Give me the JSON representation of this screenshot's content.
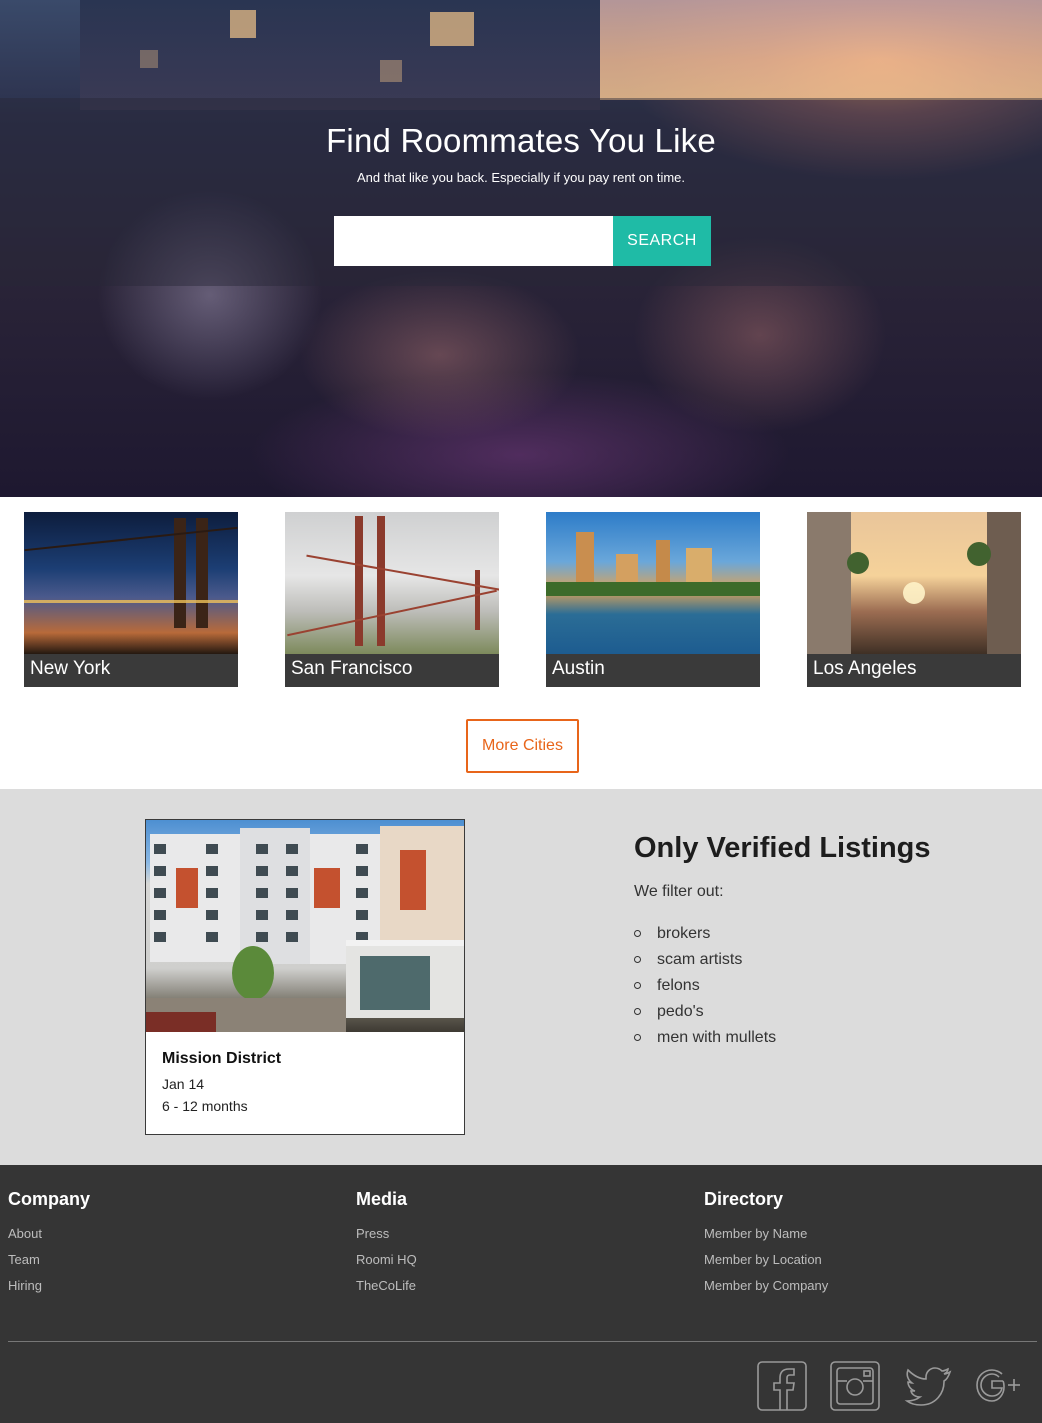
{
  "hero": {
    "title": "Find Roommates You Like",
    "subtitle": "And that like you back. Especially if you pay rent on time.",
    "search_placeholder": "",
    "search_button": "SEARCH"
  },
  "cities": [
    {
      "name": "New York"
    },
    {
      "name": "San Francisco"
    },
    {
      "name": "Austin"
    },
    {
      "name": "Los Angeles"
    }
  ],
  "more_cities_label": "More Cities",
  "listing": {
    "title": "Mission District",
    "date": "Jan 14",
    "duration": "6 - 12 months"
  },
  "verified": {
    "title": "Only Verified Listings",
    "subtitle": "We filter out:",
    "items": [
      "brokers",
      "scam artists",
      "felons",
      "pedo's",
      "men with mullets"
    ]
  },
  "footer": {
    "columns": [
      {
        "heading": "Company",
        "links": [
          "About",
          "Team",
          "Hiring"
        ]
      },
      {
        "heading": "Media",
        "links": [
          "Press",
          "Roomi HQ",
          "TheCoLife"
        ]
      },
      {
        "heading": "Directory",
        "links": [
          "Member by Name",
          "Member by Location",
          "Member by Company"
        ]
      }
    ],
    "social": [
      "facebook-icon",
      "instagram-icon",
      "twitter-icon",
      "google-plus-icon"
    ]
  },
  "colors": {
    "accent_teal": "#1fbba6",
    "accent_orange": "#e8651a",
    "footer_bg": "#353535",
    "section_bg": "#dcdcdc"
  }
}
